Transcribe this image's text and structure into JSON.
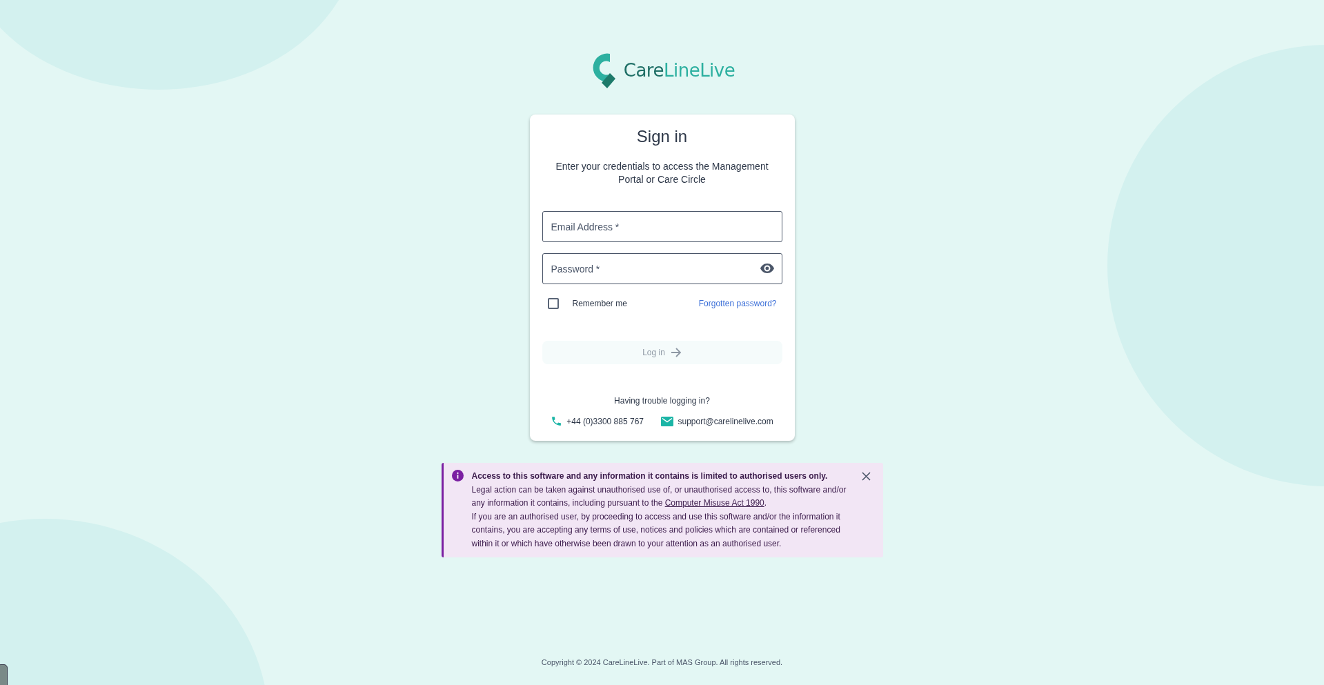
{
  "logo": {
    "text_dark": "Care",
    "text_light": "LineLive"
  },
  "sign_in": {
    "title": "Sign in",
    "subtitle": "Enter your credentials to access the Management Portal or Care Circle",
    "fields": [
      {
        "kind": "text",
        "placeholder": "Email Address *"
      },
      {
        "kind": "password",
        "placeholder": "Password *"
      }
    ],
    "remember": {
      "label": "Remember me",
      "checked": false
    },
    "forgot_link": "Forgotten password?",
    "login_button": {
      "label": "Log in",
      "disabled": true
    },
    "help": {
      "title": "Having trouble logging in?",
      "phone": "+44 (0)3300 885 767",
      "email": "support@carelinelive.com"
    }
  },
  "notice": {
    "title": "Access to this software and any information it contains is limited to authorised users only.",
    "text_before_link": "Legal action can be taken against unauthorised use of, or unauthorised access to, this software and/or any information it contains, including pursuant to the ",
    "link": "Computer Misuse Act 1990",
    "text_after_link": ".",
    "paragraph": "If you are an authorised user, by proceeding to access and use this software and/or the information it contains, you are accepting any terms of use, notices and policies which are contained or referenced within it or which have otherwise been drawn to your attention as an authorised user."
  },
  "footer": "Copyright © 2024 CareLineLive. Part of MAS Group. All rights reserved."
}
